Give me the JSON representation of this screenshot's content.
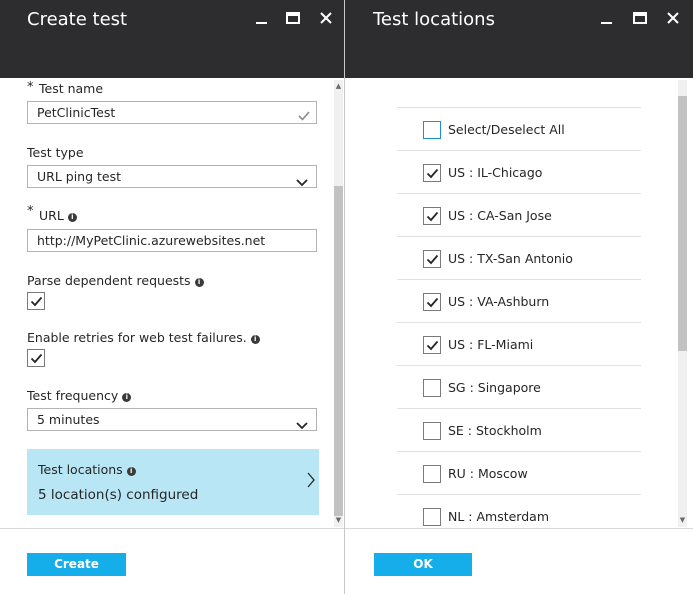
{
  "left_blade": {
    "title": "Create test",
    "fields": {
      "test_name_label": "Test name",
      "test_name_value": "PetClinicTest",
      "test_type_label": "Test type",
      "test_type_value": "URL ping test",
      "url_label": "URL",
      "url_value": "http://MyPetClinic.azurewebsites.net",
      "parse_dependent_label": "Parse dependent requests",
      "parse_dependent_checked": true,
      "enable_retries_label": "Enable retries for web test failures.",
      "enable_retries_checked": true,
      "frequency_label": "Test frequency",
      "frequency_value": "5 minutes",
      "required_marker": "*"
    },
    "locations_tile": {
      "title": "Test locations",
      "value": "5 location(s) configured"
    },
    "create_button": "Create"
  },
  "right_blade": {
    "title": "Test locations",
    "select_all_label": "Select/Deselect All",
    "locations": [
      {
        "label": "US : IL-Chicago",
        "checked": true
      },
      {
        "label": "US : CA-San Jose",
        "checked": true
      },
      {
        "label": "US : TX-San Antonio",
        "checked": true
      },
      {
        "label": "US : VA-Ashburn",
        "checked": true
      },
      {
        "label": "US : FL-Miami",
        "checked": true
      },
      {
        "label": "SG : Singapore",
        "checked": false
      },
      {
        "label": "SE : Stockholm",
        "checked": false
      },
      {
        "label": "RU : Moscow",
        "checked": false
      },
      {
        "label": "NL : Amsterdam",
        "checked": false
      }
    ],
    "ok_button": "OK"
  },
  "colors": {
    "header_bg": "#2d2d30",
    "tile_bg": "#b9e6f5",
    "primary_button": "#15aeea"
  }
}
